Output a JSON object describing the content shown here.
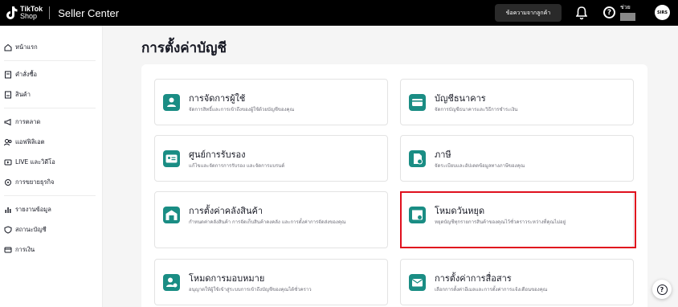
{
  "topbar": {
    "brand_line1": "TikTok",
    "brand_line2": "Shop",
    "app_title": "Seller Center",
    "messages_label": "ข้อความจากลูกค้า",
    "help_label": "ช่วย",
    "avatar_text": "SIRS"
  },
  "sidebar": {
    "items": [
      {
        "label": "หน้าแรก",
        "icon": "home-icon"
      },
      {
        "label": "คำสั่งซื้อ",
        "icon": "orders-icon"
      },
      {
        "label": "สินค้า",
        "icon": "products-icon"
      },
      {
        "label": "การตลาด",
        "icon": "megaphone-icon"
      },
      {
        "label": "แอฟฟิลิเอต",
        "icon": "affiliate-icon"
      },
      {
        "label": "LIVE และวิดีโอ",
        "icon": "live-icon"
      },
      {
        "label": "การขยายธุรกิจ",
        "icon": "growth-icon"
      },
      {
        "label": "รายงานข้อมูล",
        "icon": "chart-icon"
      },
      {
        "label": "สถานะบัญชี",
        "icon": "status-icon"
      },
      {
        "label": "การเงิน",
        "icon": "finance-icon"
      }
    ]
  },
  "main": {
    "title": "การตั้งค่าบัญชี",
    "cards": [
      {
        "title": "การจัดการผู้ใช้",
        "desc": "จัดการสิทธิ์และการเข้าถึงของผู้ใช้ด้วยบัญชีของคุณ",
        "icon": "user-icon"
      },
      {
        "title": "บัญชีธนาคาร",
        "desc": "จัดการบัญชีธนาคารและวิธีการชำระเงิน",
        "icon": "bank-card-icon"
      },
      {
        "title": "ศูนย์การรับรอง",
        "desc": "แก้ไขและจัดการการรับรอง และจัดการแบรนด์",
        "icon": "id-card-icon"
      },
      {
        "title": "ภาษี",
        "desc": "จัดระเบียบและอัปเดตข้อมูลทางภาษีของคุณ",
        "icon": "tax-icon"
      },
      {
        "title": "การตั้งค่าคลังสินค้า",
        "desc": "กำหนดค่าคลังสินค้า การจัดเก็บสินค้าคงคลัง และการตั้งค่าการจัดส่งของคุณ",
        "icon": "warehouse-icon"
      },
      {
        "title": "โหมดวันหยุด",
        "desc": "หยุดบัญชีทุกรายการสินค้าของคุณไว้ชั่วคราวระหว่างที่คุณไม่อยู่",
        "icon": "holiday-icon"
      },
      {
        "title": "โหมดการมอบหมาย",
        "desc": "อนุญาตให้ผู้ใช้เข้าสู่ระบบการเข้าถึงบัญชีของคุณได้ชั่วคราว",
        "icon": "delegate-icon"
      },
      {
        "title": "การตั้งค่าการสื่อสาร",
        "desc": "เลือกการตั้งค่าอีเมลและการตั้งค่าการแจ้งเตือนของคุณ",
        "icon": "mail-icon"
      }
    ]
  },
  "colors": {
    "accent": "#1a8d84",
    "highlight": "#e0101e",
    "topbar": "#000000"
  }
}
